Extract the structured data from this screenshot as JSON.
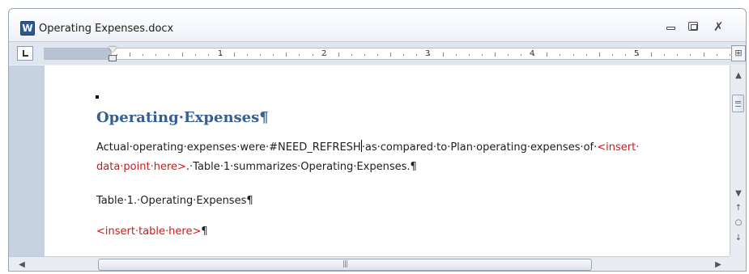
{
  "window": {
    "app_icon_letter": "W",
    "title": "Operating Expenses.docx",
    "minimize_symbol": "",
    "close_symbol": "✗"
  },
  "ruler": {
    "numbers": [
      "1",
      "2",
      "3",
      "4",
      "5"
    ],
    "view_ruler_symbol": "⊞"
  },
  "document": {
    "heading": "Operating·Expenses¶",
    "para1_a": "Actual·operating·expenses·were·#NEED_REFRESH",
    "para1_b": "·as·compared·to·Plan·operating·expenses·of·",
    "para1_c": "<insert·",
    "para2_a": "data·point·here>",
    "para2_b": ".·Table·1·summarizes·Operating·Expenses.¶",
    "caption": "Table·1.·Operating·Expenses¶",
    "placeholder_table": "<insert·table·here>",
    "placeholder_table_mark": "¶"
  },
  "scrollbars": {
    "up": "▲",
    "down": "▼",
    "prev_page": "↑",
    "select_browse": "○",
    "next_page": "↓",
    "left": "◀",
    "right": "▶",
    "thumb_grip": "|||"
  },
  "colors": {
    "heading": "#366091",
    "placeholder": "#d01818"
  }
}
